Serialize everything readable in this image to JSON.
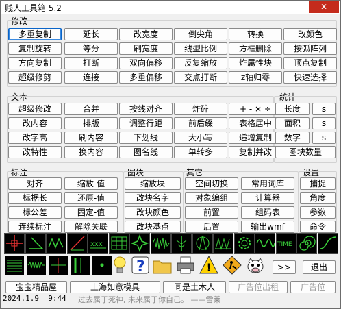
{
  "title": "贱人工具箱 5.2",
  "close_glyph": "✕",
  "sections": {
    "modify": "修改",
    "text": "文本",
    "stats": "统计",
    "annotate": "标注",
    "block": "图块",
    "other": "其它",
    "settings": "设置"
  },
  "modify_buttons": [
    "多重复制",
    "延长",
    "改宽度",
    "倒尖角",
    "转换",
    "改颜色",
    "复制旋转",
    "等分",
    "刷宽度",
    "线型比例",
    "方框删除",
    "按弧阵列",
    "方向复制",
    "打断",
    "双向偏移",
    "反复缩放",
    "炸属性块",
    "顶点复制",
    "超级修剪",
    "连接",
    "多重偏移",
    "交点打断",
    "z轴归零",
    "快速选择"
  ],
  "text_buttons": [
    "超级修改",
    "合并",
    "按线对齐",
    "炸碎",
    "+ - × ÷",
    "改内容",
    "排版",
    "调整行距",
    "前后缀",
    "表格居中",
    "改字高",
    "刷内容",
    "下划线",
    "大小写",
    "递增复制",
    "改特性",
    "换内容",
    "图名线",
    "单转多",
    "复制并改"
  ],
  "stats_buttons": [
    "长度",
    "s",
    "面积",
    "s",
    "数字",
    "s",
    "图块数量"
  ],
  "annotate_buttons": [
    "对齐",
    "缩放-值",
    "标据长",
    "还原-值",
    "标公差",
    "固定-值",
    "连续标注",
    "解除关联"
  ],
  "block_buttons": [
    "缩放块",
    "改块名字",
    "改块颜色",
    "改块基点"
  ],
  "other_buttons": [
    "空间切换",
    "常用词库",
    "对象编组",
    "计算器",
    "前置",
    "组码表",
    "后置",
    "输出wmf"
  ],
  "settings_buttons": [
    "捕捉",
    "角度",
    "参数",
    "命令"
  ],
  "icon_tools": [
    "crosshair-icon",
    "angle-icon",
    "zigzag-icon",
    "slope-icon",
    "hatch-xxx-icon",
    "grid-icon",
    "star-icon",
    "wave-icon",
    "tree-icon",
    "compass-icon",
    "hatch-cross-icon",
    "gear-icon",
    "sine-icon",
    "time-text-icon",
    "spiral-icon",
    "curve-icon"
  ],
  "icon_time_label": "TIME",
  "icon_tools_2": [
    "lines-icon",
    "spring-icon",
    "cross-icon",
    "bars-icon",
    "dot-icon",
    "bulb-icon",
    "help-icon",
    "folder-icon",
    "printer-icon",
    "warning-icon",
    "construction-icon",
    "cow-icon"
  ],
  "help_glyph": "?",
  "warning_glyph": "!",
  "next_button": ">>",
  "exit_button": "退出",
  "links": [
    "宝宝精品屋",
    "上海如意模具",
    "同是土木人",
    "广告位出租",
    "广告位"
  ],
  "date": "2024.1.9",
  "time": "9:44",
  "motto": "过去属于死神, 未来属于你自己。 ——雪莱",
  "colors": {
    "close": "#c42b1c",
    "toolbar_bg": "#000000",
    "tool_fg": "#2ecc40"
  }
}
